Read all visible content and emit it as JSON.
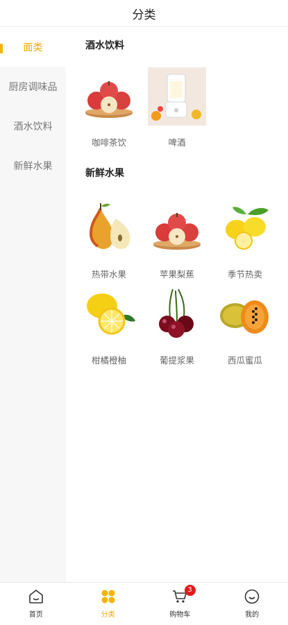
{
  "header": {
    "title": "分类"
  },
  "sidebar": {
    "items": [
      {
        "label": "面类",
        "active": true
      },
      {
        "label": "厨房调味品",
        "active": false
      },
      {
        "label": "酒水饮料",
        "active": false
      },
      {
        "label": "新鲜水果",
        "active": false
      }
    ]
  },
  "sections": [
    {
      "title": "酒水饮料",
      "items": [
        {
          "label": "咖啡茶饮",
          "image": "apples-on-board"
        },
        {
          "label": "啤酒",
          "image": "juice-blender"
        }
      ]
    },
    {
      "title": "新鲜水果",
      "items": [
        {
          "label": "热带水果",
          "image": "pear"
        },
        {
          "label": "苹果梨蕉",
          "image": "apples-on-board"
        },
        {
          "label": "季节热卖",
          "image": "lemons"
        },
        {
          "label": "柑橘橙柚",
          "image": "lemon-slice"
        },
        {
          "label": "葡提浆果",
          "image": "cherries"
        },
        {
          "label": "西瓜蜜瓜",
          "image": "papaya"
        }
      ]
    }
  ],
  "tabbar": {
    "items": [
      {
        "label": "首页",
        "icon": "home-icon"
      },
      {
        "label": "分类",
        "icon": "category-icon",
        "active": true
      },
      {
        "label": "购物车",
        "icon": "cart-icon",
        "badge": "3"
      },
      {
        "label": "我的",
        "icon": "profile-icon"
      }
    ]
  },
  "colors": {
    "accent": "#f2a900",
    "badge": "#e21b1b",
    "sidebar_bg": "#f7f7f7"
  }
}
